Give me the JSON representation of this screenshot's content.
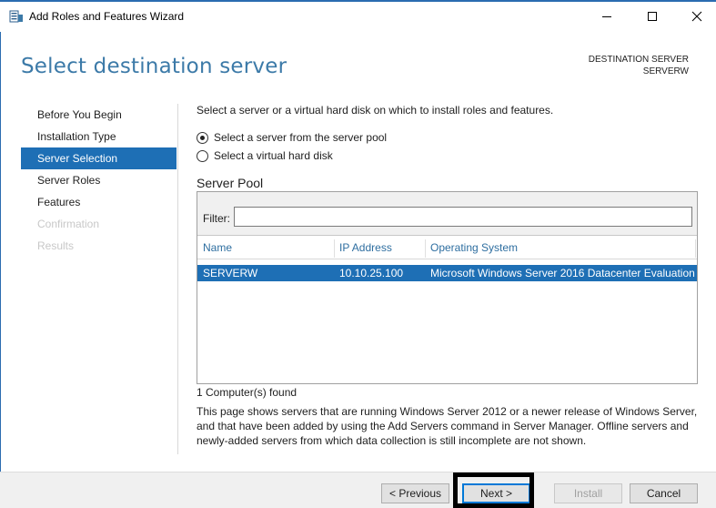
{
  "window": {
    "title": "Add Roles and Features Wizard"
  },
  "header": {
    "page_title": "Select destination server",
    "destination_label": "DESTINATION SERVER",
    "destination_name": "SERVERW"
  },
  "nav": {
    "items": [
      {
        "label": "Before You Begin",
        "state": "normal"
      },
      {
        "label": "Installation Type",
        "state": "normal"
      },
      {
        "label": "Server Selection",
        "state": "active"
      },
      {
        "label": "Server Roles",
        "state": "normal"
      },
      {
        "label": "Features",
        "state": "normal"
      },
      {
        "label": "Confirmation",
        "state": "disabled"
      },
      {
        "label": "Results",
        "state": "disabled"
      }
    ]
  },
  "main": {
    "intro": "Select a server or a virtual hard disk on which to install roles and features.",
    "option_pool": "Select a server from the server pool",
    "option_vhd": "Select a virtual hard disk",
    "selected_option": "pool",
    "pool_title": "Server Pool",
    "filter_label": "Filter:",
    "filter_value": "",
    "columns": [
      "Name",
      "IP Address",
      "Operating System"
    ],
    "rows": [
      {
        "name": "SERVERW",
        "ip": "10.10.25.100",
        "os": "Microsoft Windows Server 2016 Datacenter Evaluation",
        "selected": true
      }
    ],
    "found_text": "1 Computer(s) found",
    "description": "This page shows servers that are running Windows Server 2012 or a newer release of Windows Server, and that have been added by using the Add Servers command in Server Manager. Offline servers and newly-added servers from which data collection is still incomplete are not shown."
  },
  "footer": {
    "previous_label": "< Previous",
    "next_label": "Next >",
    "install_label": "Install",
    "cancel_label": "Cancel"
  },
  "colors": {
    "accent": "#1e6fb5",
    "title_blue": "#3c7aa8",
    "column_header": "#2e6ea0"
  },
  "icons": {
    "app": "server-manager-icon",
    "minimize": "minimize-icon",
    "maximize": "maximize-icon",
    "close": "close-icon"
  }
}
